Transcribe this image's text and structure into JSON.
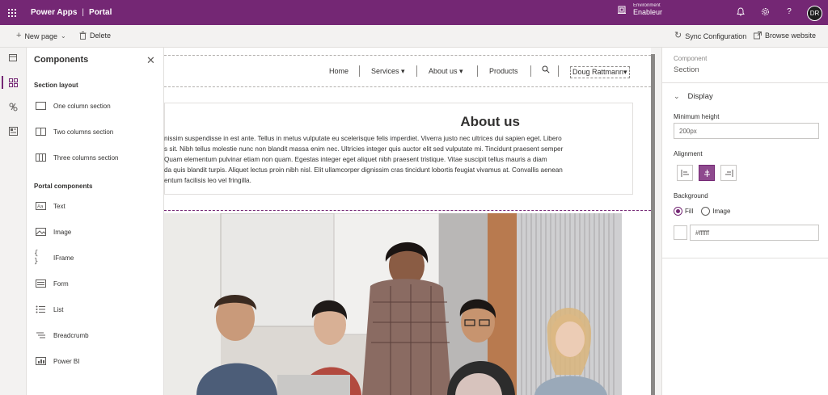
{
  "header": {
    "app_name": "Power Apps",
    "separator": "|",
    "product": "Portal",
    "environment_label": "Environment",
    "environment_value": "Enableur",
    "avatar_initials": "DR",
    "brand_color": "#742774"
  },
  "commandbar": {
    "new_page": "New page",
    "delete": "Delete",
    "sync": "Sync Configuration",
    "browse": "Browse website"
  },
  "components_panel": {
    "title": "Components",
    "section_layout_heading": "Section layout",
    "section_layouts": [
      "One column section",
      "Two columns section",
      "Three columns section"
    ],
    "portal_components_heading": "Portal components",
    "portal_components": [
      "Text",
      "Image",
      "IFrame",
      "Form",
      "List",
      "Breadcrumb",
      "Power BI"
    ]
  },
  "site": {
    "nav": {
      "home": "Home",
      "services": "Services",
      "about": "About us",
      "products": "Products",
      "user": "Doug Rattmann"
    },
    "about_title": "About us",
    "about_lines": [
      "nissim suspendisse in est ante. Tellus in metus vulputate eu scelerisque felis imperdiet. Viverra justo nec ultrices dui sapien eget. Libero",
      "s sit. Nibh tellus molestie nunc non blandit massa enim nec. Ultricies integer quis auctor elit sed vulputate mi. Tincidunt praesent semper",
      "Quam elementum pulvinar etiam non quam. Egestas integer eget aliquet nibh praesent tristique. Vitae suscipit tellus mauris a diam",
      "da quis blandit turpis. Aliquet lectus proin nibh nisl. Elit ullamcorper dignissim cras tincidunt lobortis feugiat vivamus at. Convallis aenean",
      "entum facilisis leo vel fringilla."
    ]
  },
  "properties": {
    "subtitle": "Component",
    "title": "Section",
    "display_label": "Display",
    "min_height_label": "Minimum height",
    "min_height_value": "200px",
    "alignment_label": "Alignment",
    "background_label": "Background",
    "fill_label": "Fill",
    "image_label": "Image",
    "color_value": "#ffffff"
  }
}
